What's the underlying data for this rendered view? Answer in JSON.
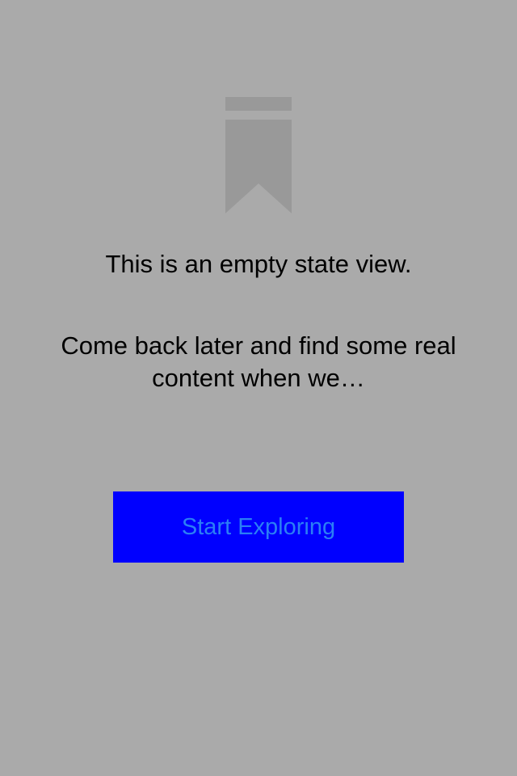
{
  "empty_state": {
    "icon": "bookmark-icon",
    "title": "This is an empty state view.",
    "body": "Come back later and find some real content when we…",
    "button_label": "Start Exploring"
  },
  "colors": {
    "background": "#aaaaaa",
    "icon": "#999999",
    "text": "#000000",
    "button_background": "#0000ff",
    "button_text": "#2b7ff5"
  }
}
